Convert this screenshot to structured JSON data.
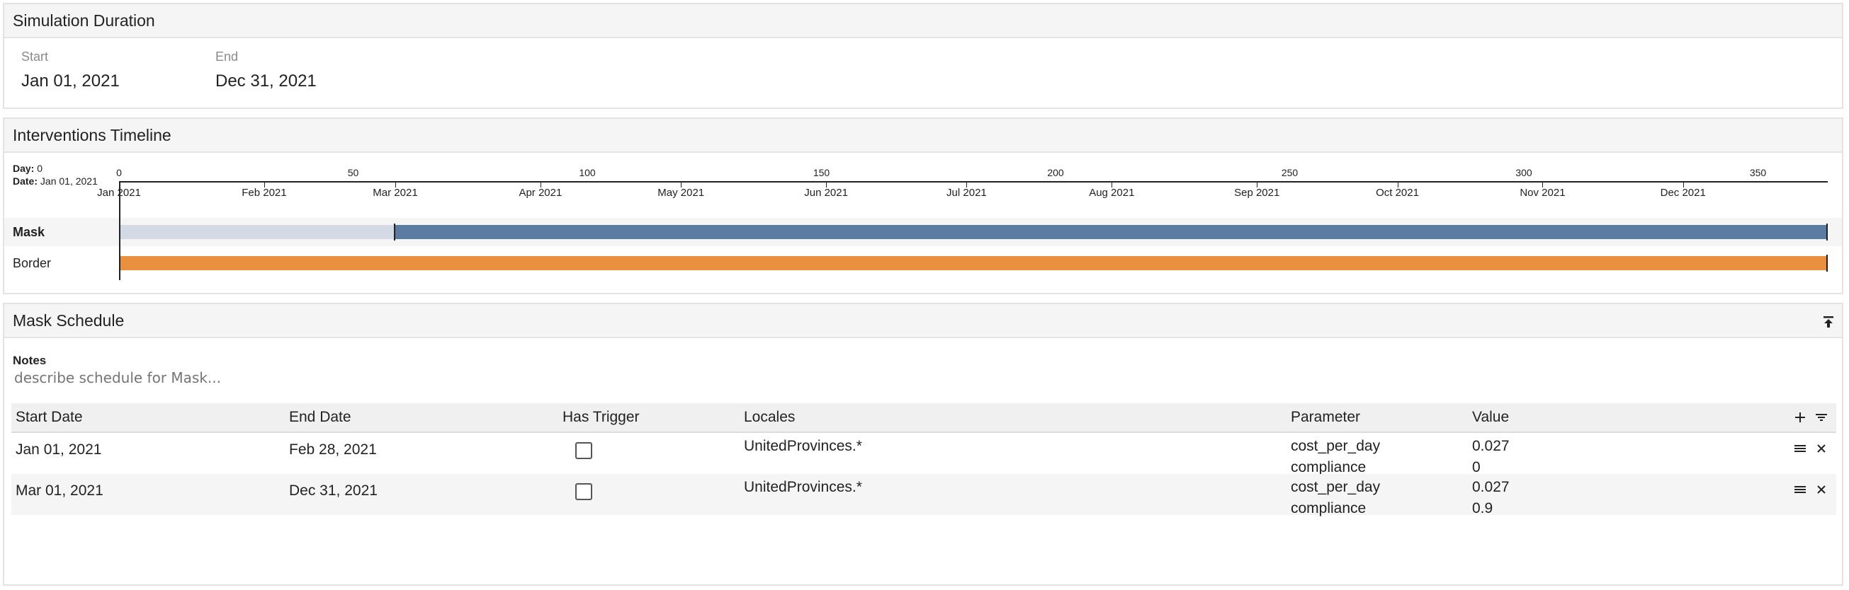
{
  "duration": {
    "title": "Simulation Duration",
    "start_label": "Start",
    "start_value": "Jan 01, 2021",
    "end_label": "End",
    "end_value": "Dec 31, 2021"
  },
  "timeline": {
    "title": "Interventions Timeline",
    "day_label": "Day:",
    "day_value": "0",
    "date_label": "Date:",
    "date_value": "Jan 01, 2021",
    "day_ticks": [
      "0",
      "50",
      "100",
      "150",
      "200",
      "250",
      "300",
      "350"
    ],
    "month_ticks": [
      "Jan 2021",
      "Feb 2021",
      "Mar 2021",
      "Apr 2021",
      "May 2021",
      "Jun 2021",
      "Jul 2021",
      "Aug 2021",
      "Sep 2021",
      "Oct 2021",
      "Nov 2021",
      "Dec 2021"
    ],
    "rows": [
      {
        "label": "Mask",
        "bold": true
      },
      {
        "label": "Border",
        "bold": false
      }
    ],
    "colors": {
      "mask_inactive": "#d3d9e5",
      "mask_active": "#5b7ba3",
      "border": "#e8903e"
    }
  },
  "schedule": {
    "title": "Mask Schedule",
    "notes_label": "Notes",
    "notes_value": "describe schedule for Mask...",
    "columns": {
      "start": "Start Date",
      "end": "End Date",
      "trigger": "Has Trigger",
      "locales": "Locales",
      "parameter": "Parameter",
      "value": "Value"
    },
    "rows": [
      {
        "start": "Jan 01, 2021",
        "end": "Feb 28, 2021",
        "trigger": false,
        "locales": "UnitedProvinces.*",
        "param1": "cost_per_day",
        "value1": "0.027",
        "param2": "compliance",
        "value2": "0"
      },
      {
        "start": "Mar 01, 2021",
        "end": "Dec 31, 2021",
        "trigger": false,
        "locales": "UnitedProvinces.*",
        "param1": "cost_per_day",
        "value1": "0.027",
        "param2": "compliance",
        "value2": "0.9"
      }
    ],
    "icons": {
      "collapse": "collapse-up-icon",
      "add": "plus-icon",
      "filter": "filter-icon",
      "menu": "menu-icon",
      "delete": "close-icon"
    }
  }
}
